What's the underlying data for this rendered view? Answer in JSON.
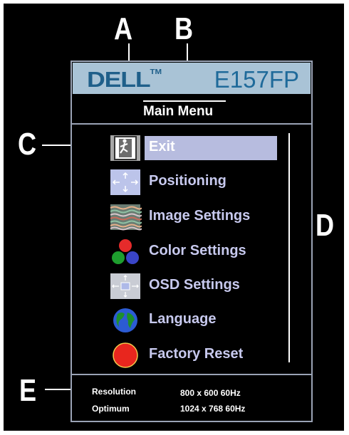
{
  "callouts": {
    "a": "A",
    "b": "B",
    "c": "C",
    "d": "D",
    "e": "E"
  },
  "brand": {
    "logo_text": "DELL",
    "logo_tm": "TM",
    "model": "E157FP"
  },
  "menu": {
    "title": "Main Menu",
    "items": [
      {
        "label": "Exit",
        "icon": "exit-icon",
        "selected": true
      },
      {
        "label": "Positioning",
        "icon": "positioning-icon"
      },
      {
        "label": "Image Settings",
        "icon": "image-settings-icon"
      },
      {
        "label": "Color Settings",
        "icon": "color-settings-icon"
      },
      {
        "label": "OSD Settings",
        "icon": "osd-settings-icon"
      },
      {
        "label": "Language",
        "icon": "globe-icon"
      },
      {
        "label": "Factory Reset",
        "icon": "factory-reset-icon"
      }
    ]
  },
  "info": {
    "resolution_label": "Resolution",
    "resolution_value": "800 x 600  60Hz",
    "optimum_label": "Optimum",
    "optimum_value": "1024 x 768  60Hz"
  },
  "colors": {
    "osd_background": "#000000",
    "header_bg": "#a9c3d6",
    "brand_blue": "#1f6a9a",
    "selection_bg": "#b7bcdf",
    "item_text": "#c7c9ee"
  }
}
